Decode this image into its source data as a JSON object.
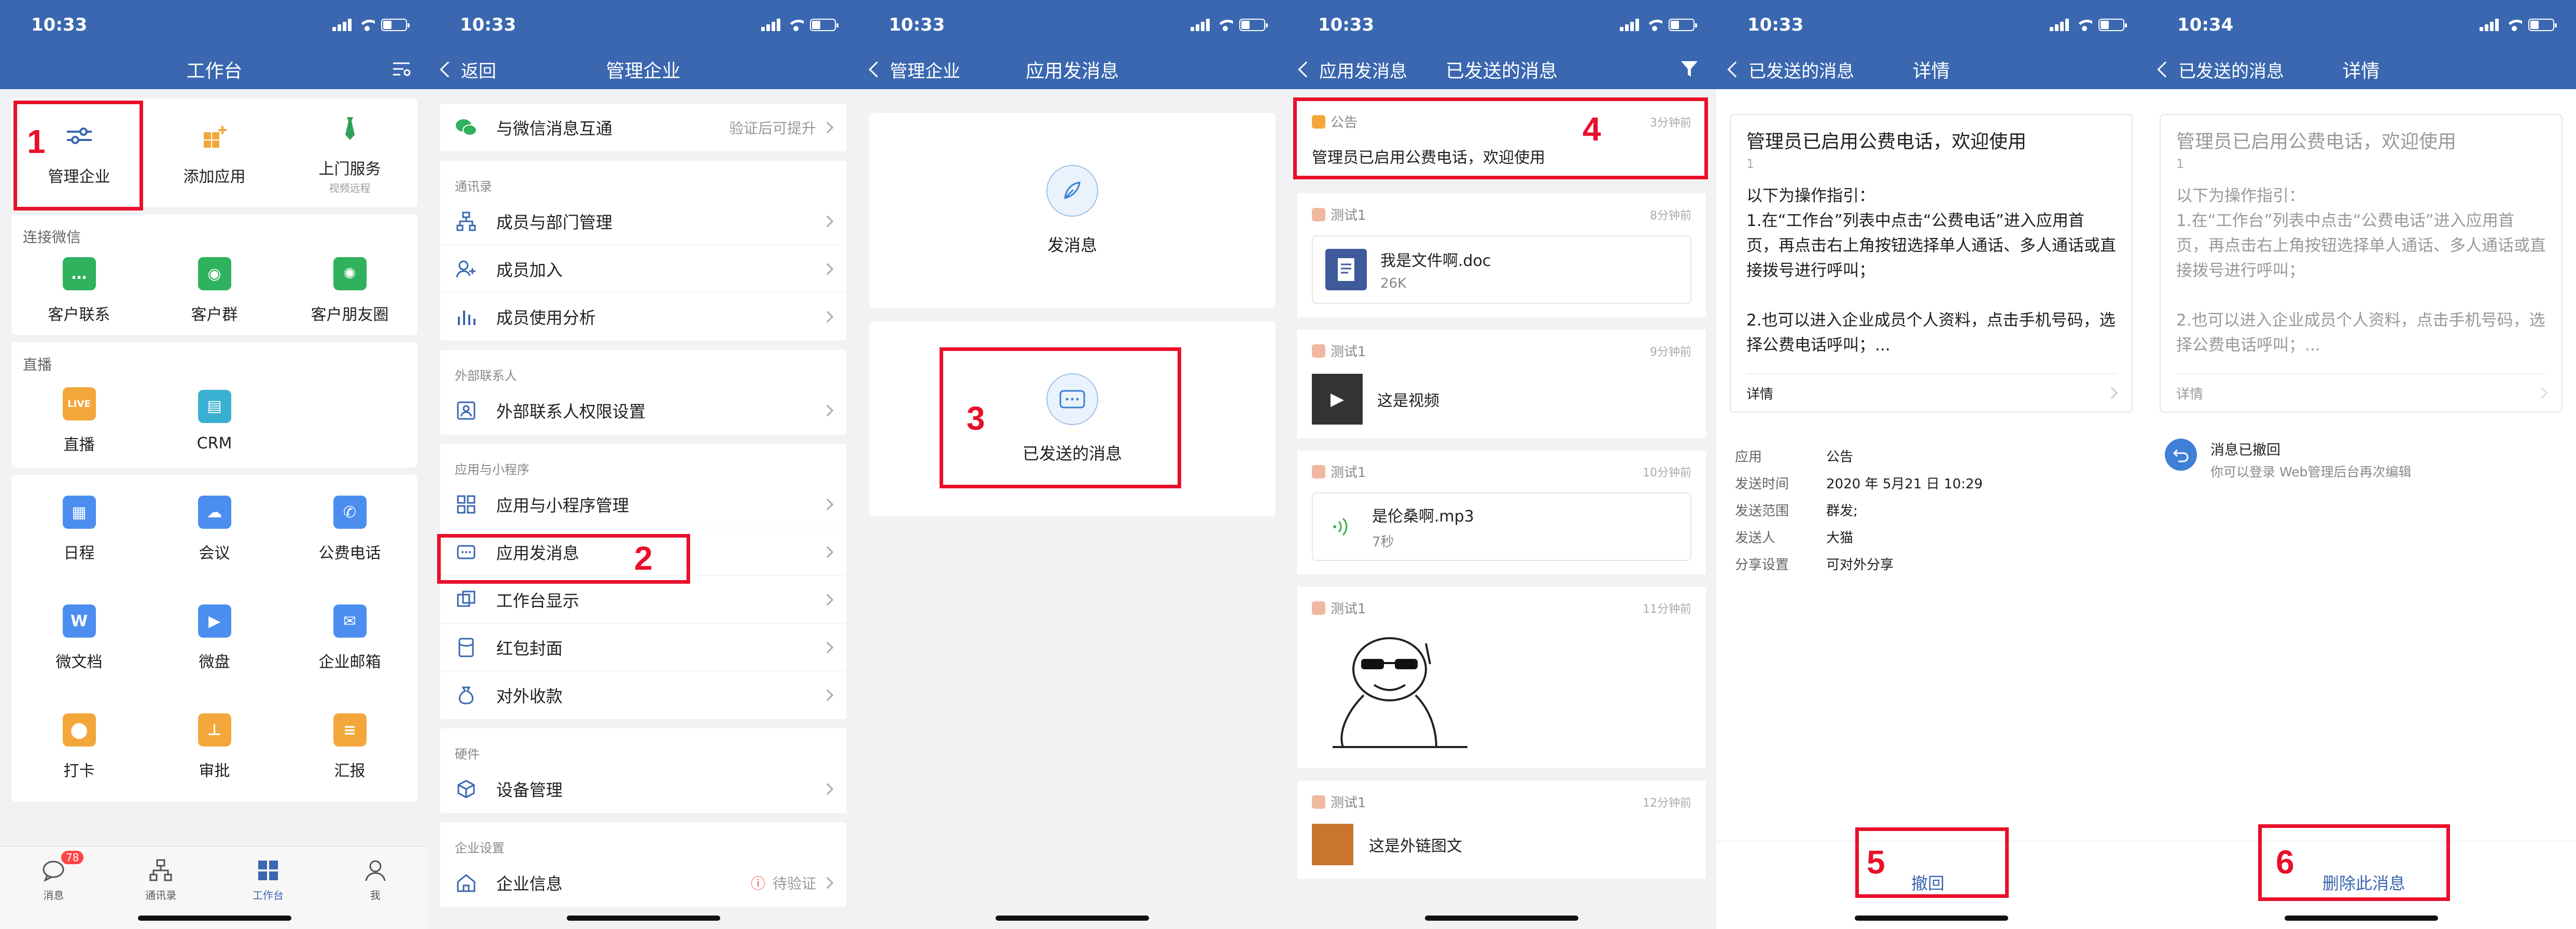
{
  "status": {
    "time_a": "10:33",
    "time_b": "10:34"
  },
  "p1": {
    "title": "工作台",
    "top_items": [
      {
        "label": "管理企业",
        "sub": ""
      },
      {
        "label": "添加应用",
        "sub": ""
      },
      {
        "label": "上门服务",
        "sub": "视频远程"
      }
    ],
    "sec_wechat": "连接微信",
    "wechat_items": [
      {
        "label": "客户联系"
      },
      {
        "label": "客户群"
      },
      {
        "label": "客户朋友圈"
      }
    ],
    "sec_live": "直播",
    "live_items": [
      {
        "label": "直播",
        "icon_text": "LIVE"
      },
      {
        "label": "CRM"
      }
    ],
    "apps": [
      {
        "label": "日程"
      },
      {
        "label": "会议"
      },
      {
        "label": "公费电话"
      },
      {
        "label": "微文档",
        "icon_text": "W"
      },
      {
        "label": "微盘"
      },
      {
        "label": "企业邮箱"
      },
      {
        "label": "打卡"
      },
      {
        "label": "审批"
      },
      {
        "label": "汇报"
      }
    ],
    "tabs": [
      {
        "label": "消息",
        "badge": "78"
      },
      {
        "label": "通讯录"
      },
      {
        "label": "工作台"
      },
      {
        "label": "我"
      }
    ],
    "marker": "1"
  },
  "p2": {
    "back": "返回",
    "title": "管理企业",
    "wechat_row": {
      "label": "与微信消息互通",
      "right": "验证后可提升"
    },
    "g1": "通讯录",
    "g1_items": [
      "成员与部门管理",
      "成员加入",
      "成员使用分析"
    ],
    "g2": "外部联系人",
    "g2_items": [
      "外部联系人权限设置"
    ],
    "g3": "应用与小程序",
    "g3_items": [
      "应用与小程序管理",
      "应用发消息",
      "工作台显示",
      "红包封面",
      "对外收款"
    ],
    "g4": "硬件",
    "g4_items": [
      "设备管理"
    ],
    "g5": "企业设置",
    "g5_row": {
      "label": "企业信息",
      "right": "待验证"
    },
    "marker": "2"
  },
  "p3": {
    "back": "管理企业",
    "title": "应用发消息",
    "send": "发消息",
    "sent": "已发送的消息",
    "marker": "3"
  },
  "p4": {
    "back": "应用发消息",
    "title": "已发送的消息",
    "messages": [
      {
        "source": "公告",
        "time": "3分钟前",
        "text": "管理员已启用公费电话，欢迎使用"
      },
      {
        "source": "测试1",
        "time": "8分钟前",
        "file": "我是文件啊.doc",
        "size": "26K"
      },
      {
        "source": "测试1",
        "time": "9分钟前",
        "text": "这是视频"
      },
      {
        "source": "测试1",
        "time": "10分钟前",
        "file": "是伦桑啊.mp3",
        "size": "7秒"
      },
      {
        "source": "测试1",
        "time": "11分钟前"
      },
      {
        "source": "测试1",
        "time": "12分钟前",
        "text": "这是外链图文"
      }
    ],
    "marker": "4"
  },
  "p5": {
    "back": "已发送的消息",
    "title": "详情",
    "card_title": "管理员已启用公费电话，欢迎使用",
    "card_num": "1",
    "card_body": "以下为操作指引：\n1.在“工作台”列表中点击“公费电话”进入应用首页，再点击右上角按钮选择单人通话、多人通话或直接拨号进行呼叫；\n\n2.也可以进入企业成员个人资料，点击手机号码，选择公费电话呼叫；...",
    "card_foot": "详情",
    "info": [
      {
        "k": "应用",
        "v": "公告"
      },
      {
        "k": "发送时间",
        "v": "2020 年 5月21 日 10:29"
      },
      {
        "k": "发送范围",
        "v": "群发;"
      },
      {
        "k": "发送人",
        "v": "大猫"
      },
      {
        "k": "分享设置",
        "v": "可对外分享"
      }
    ],
    "action": "撤回",
    "marker": "5"
  },
  "p6": {
    "back": "已发送的消息",
    "title": "详情",
    "notice_title": "消息已撤回",
    "notice_sub": "你可以登录 Web管理后台再次编辑",
    "action": "删除此消息",
    "marker": "6"
  },
  "colors": {
    "nav": "#3a67b0",
    "highlight": "#e8102a"
  }
}
